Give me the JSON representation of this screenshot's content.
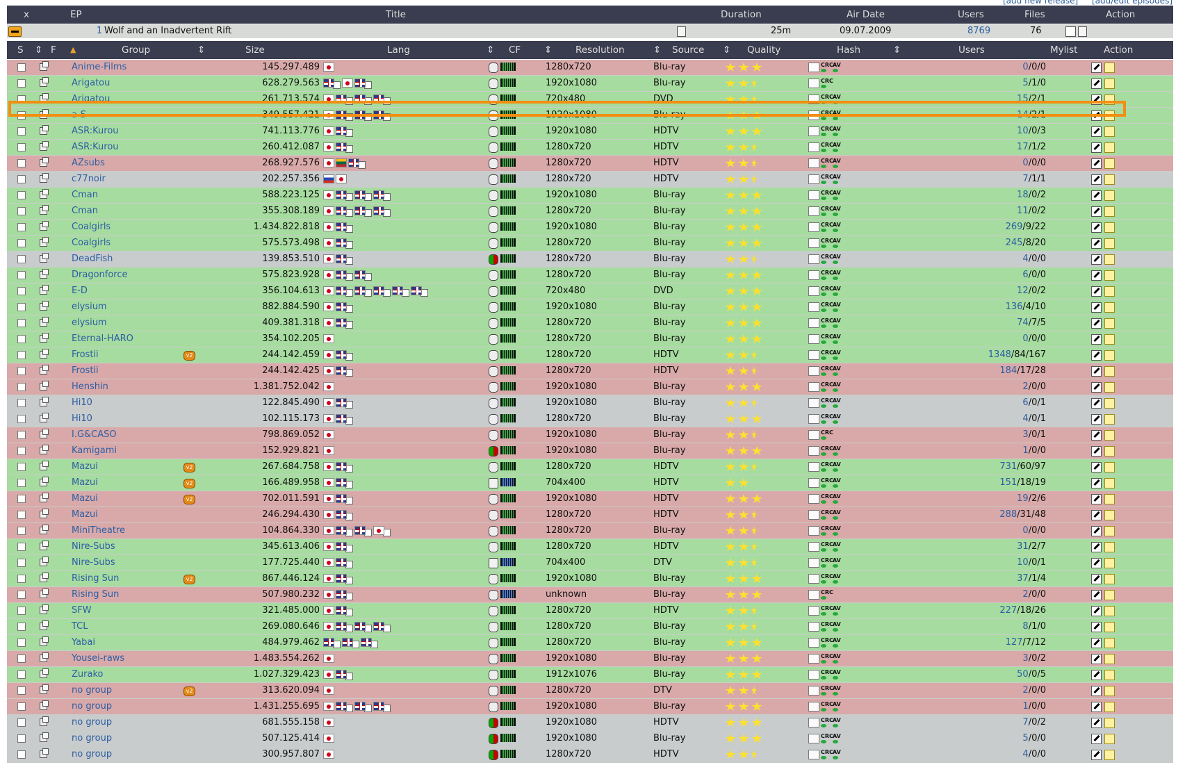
{
  "toplinks": [
    "[add new release]",
    "[add/edit episodes]"
  ],
  "episode_header": {
    "x": "x",
    "ep": "EP",
    "title": "Title",
    "duration": "Duration",
    "airdate": "Air Date",
    "users": "Users",
    "files": "Files",
    "action": "Action"
  },
  "episode": {
    "number": "1",
    "title": "Wolf and an Inadvertent Rift",
    "duration": "25m",
    "airdate": "09.07.2009",
    "users": "8769",
    "files": "76"
  },
  "group_header": {
    "s": "S",
    "f": "F",
    "group": "Group",
    "size": "Size",
    "lang": "Lang",
    "cf": "CF",
    "resolution": "Resolution",
    "source": "Source",
    "quality": "Quality",
    "hash": "Hash",
    "users": "Users",
    "mylist": "Mylist",
    "action": "Action"
  },
  "rows": [
    {
      "group": "Anime-Films",
      "size": "145.297.489",
      "langs": [
        "jp"
      ],
      "cf": "normal",
      "res": "1280x720",
      "src": "Blu-ray",
      "q": "3",
      "hash": "full",
      "users": "0/0/0",
      "color": "pink"
    },
    {
      "group": "Arigatou",
      "size": "628.279.563",
      "langs": [
        "en",
        "jp",
        "sub-en"
      ],
      "cf": "normal",
      "res": "1920x1080",
      "src": "Blu-ray",
      "q": "2.5",
      "hash": "part",
      "users": "5/1/0",
      "color": "green"
    },
    {
      "group": "Arigatou",
      "size": "261.713.574",
      "langs": [
        "jp",
        "en",
        "en",
        "en"
      ],
      "cf": "normal",
      "res": "720x480",
      "src": "DVD",
      "q": "2.5",
      "hash": "full",
      "users": "15/2/1",
      "color": "green"
    },
    {
      "group": "a-S",
      "size": "349.557.421",
      "langs": [
        "jp",
        "en",
        "en",
        "en"
      ],
      "cf": "normal",
      "res": "1920x1080",
      "src": "Blu-ray",
      "q": "3",
      "hash": "full",
      "users": "14/2/1",
      "color": "green"
    },
    {
      "group": "ASR:Kurou",
      "size": "741.113.776",
      "langs": [
        "jp",
        "en"
      ],
      "cf": "normal",
      "res": "1920x1080",
      "src": "HDTV",
      "q": "3",
      "hash": "full",
      "users": "10/0/3",
      "color": "green"
    },
    {
      "group": "ASR:Kurou",
      "size": "260.412.087",
      "langs": [
        "jp",
        "en"
      ],
      "cf": "normal",
      "res": "1280x720",
      "src": "HDTV",
      "q": "2.5",
      "hash": "full",
      "users": "17/1/2",
      "color": "green"
    },
    {
      "group": "AZsubs",
      "size": "268.927.576",
      "langs": [
        "jp",
        "lt",
        "en"
      ],
      "cf": "normal",
      "res": "1280x720",
      "src": "HDTV",
      "q": "2.5",
      "hash": "full",
      "users": "0/0/0",
      "color": "pink"
    },
    {
      "group": "c77noir",
      "size": "202.257.356",
      "langs": [
        "ru",
        "jp"
      ],
      "cf": "normal",
      "res": "1280x720",
      "src": "HDTV",
      "q": "2.5",
      "hash": "full",
      "users": "7/1/1",
      "color": "gray"
    },
    {
      "group": "Cman",
      "size": "588.223.125",
      "langs": [
        "jp",
        "en",
        "en",
        "en"
      ],
      "cf": "normal",
      "res": "1920x1080",
      "src": "Blu-ray",
      "q": "3",
      "hash": "full",
      "users": "18/0/2",
      "color": "green"
    },
    {
      "group": "Cman",
      "size": "355.308.189",
      "langs": [
        "jp",
        "en",
        "en",
        "en"
      ],
      "cf": "normal",
      "res": "1280x720",
      "src": "Blu-ray",
      "q": "3",
      "hash": "full",
      "users": "11/0/2",
      "color": "green"
    },
    {
      "group": "Coalgirls",
      "size": "1.434.822.818",
      "langs": [
        "jp",
        "en"
      ],
      "cf": "normal",
      "res": "1920x1080",
      "src": "Blu-ray",
      "q": "3",
      "hash": "full",
      "users": "269/9/22",
      "color": "green"
    },
    {
      "group": "Coalgirls",
      "size": "575.573.498",
      "langs": [
        "jp",
        "en"
      ],
      "cf": "normal",
      "res": "1280x720",
      "src": "Blu-ray",
      "q": "3",
      "hash": "full",
      "users": "245/8/20",
      "color": "green"
    },
    {
      "group": "DeadFish",
      "size": "139.853.510",
      "langs": [
        "jp",
        "en"
      ],
      "cf": "mix",
      "res": "1280x720",
      "src": "Blu-ray",
      "q": "2.5",
      "hash": "full",
      "users": "4/0/0",
      "color": "gray"
    },
    {
      "group": "Dragonforce",
      "size": "575.823.928",
      "langs": [
        "jp",
        "en",
        "en"
      ],
      "cf": "normal",
      "res": "1280x720",
      "src": "Blu-ray",
      "q": "3",
      "hash": "full",
      "users": "6/0/0",
      "color": "green"
    },
    {
      "group": "E-D",
      "size": "356.104.613",
      "langs": [
        "jp",
        "en",
        "en",
        "en",
        "en",
        "en"
      ],
      "cf": "normal",
      "res": "720x480",
      "src": "DVD",
      "q": "3",
      "hash": "full",
      "users": "12/0/2",
      "color": "green"
    },
    {
      "group": "elysium",
      "size": "882.884.590",
      "langs": [
        "jp",
        "en"
      ],
      "cf": "normal",
      "res": "1920x1080",
      "src": "Blu-ray",
      "q": "3",
      "hash": "full",
      "users": "136/4/10",
      "color": "green"
    },
    {
      "group": "elysium",
      "size": "409.381.318",
      "langs": [
        "jp",
        "en"
      ],
      "cf": "normal",
      "res": "1280x720",
      "src": "Blu-ray",
      "q": "3",
      "hash": "full",
      "users": "74/7/5",
      "color": "green"
    },
    {
      "group": "Eternal-HARO",
      "size": "354.102.205",
      "langs": [
        "jp"
      ],
      "cf": "normal",
      "res": "1280x720",
      "src": "Blu-ray",
      "q": "3",
      "hash": "full",
      "users": "0/0/0",
      "color": "green"
    },
    {
      "group": "Frostii",
      "v2": "v2",
      "size": "244.142.459",
      "langs": [
        "jp",
        "en"
      ],
      "cf": "normal",
      "res": "1280x720",
      "src": "HDTV",
      "q": "2.5",
      "hash": "full",
      "users": "1348/84/167",
      "color": "green"
    },
    {
      "group": "Frostii",
      "size": "244.142.425",
      "langs": [
        "jp",
        "en"
      ],
      "cf": "normal",
      "res": "1280x720",
      "src": "HDTV",
      "q": "2.5",
      "hash": "full",
      "users": "184/17/28",
      "color": "pink"
    },
    {
      "group": "Henshin",
      "size": "1.381.752.042",
      "langs": [
        "jp"
      ],
      "cf": "normal",
      "res": "1920x1080",
      "src": "Blu-ray",
      "q": "3",
      "hash": "full",
      "users": "2/0/0",
      "color": "pink"
    },
    {
      "group": "Hi10",
      "size": "122.845.490",
      "langs": [
        "jp",
        "en"
      ],
      "cf": "normal",
      "res": "1920x1080",
      "src": "Blu-ray",
      "q": "2.5",
      "hash": "full",
      "users": "6/0/1",
      "color": "gray"
    },
    {
      "group": "Hi10",
      "size": "102.115.173",
      "langs": [
        "jp",
        "en"
      ],
      "cf": "normal",
      "res": "1280x720",
      "src": "Blu-ray",
      "q": "3",
      "hash": "full",
      "users": "4/0/1",
      "color": "gray"
    },
    {
      "group": "I.G&CASO",
      "size": "798.869.052",
      "langs": [
        "jp"
      ],
      "cf": "normal",
      "res": "1920x1080",
      "src": "Blu-ray",
      "q": "2.5",
      "hash": "crc",
      "users": "3/0/1",
      "color": "pink"
    },
    {
      "group": "Kamigami",
      "size": "152.929.821",
      "langs": [
        "jp"
      ],
      "cf": "mix",
      "res": "1920x1080",
      "src": "Blu-ray",
      "q": "3",
      "hash": "full",
      "users": "1/0/0",
      "color": "pink"
    },
    {
      "group": "Mazui",
      "v2": "v2",
      "size": "267.684.758",
      "langs": [
        "jp",
        "en"
      ],
      "cf": "normal",
      "res": "1280x720",
      "src": "HDTV",
      "q": "2.5",
      "hash": "full",
      "users": "731/60/97",
      "color": "green"
    },
    {
      "group": "Mazui",
      "v2": "v2",
      "size": "166.489.958",
      "langs": [
        "jp",
        "en"
      ],
      "cf": "square",
      "res": "704x400",
      "src": "HDTV",
      "q": "2",
      "hash": "full",
      "users": "151/18/19",
      "color": "green"
    },
    {
      "group": "Mazui",
      "v2": "v2",
      "size": "702.011.591",
      "langs": [
        "jp",
        "en"
      ],
      "cf": "normal",
      "res": "1920x1080",
      "src": "HDTV",
      "q": "3",
      "hash": "full",
      "users": "19/2/6",
      "color": "pink"
    },
    {
      "group": "Mazui",
      "size": "246.294.430",
      "langs": [
        "jp",
        "en"
      ],
      "cf": "normal",
      "res": "1280x720",
      "src": "HDTV",
      "q": "2.5",
      "hash": "full",
      "users": "288/31/48",
      "color": "pink"
    },
    {
      "group": "MiniTheatre",
      "size": "104.864.330",
      "langs": [
        "jp",
        "en",
        "en",
        "jp-sub"
      ],
      "cf": "normal",
      "res": "1280x720",
      "src": "Blu-ray",
      "q": "2.5",
      "hash": "full",
      "users": "0/0/0",
      "color": "pink"
    },
    {
      "group": "Nire-Subs",
      "size": "345.613.406",
      "langs": [
        "jp",
        "en"
      ],
      "cf": "normal",
      "res": "1280x720",
      "src": "HDTV",
      "q": "2.5",
      "hash": "full",
      "users": "31/2/7",
      "color": "green"
    },
    {
      "group": "Nire-Subs",
      "size": "177.725.440",
      "langs": [
        "jp",
        "en"
      ],
      "cf": "square",
      "res": "704x400",
      "src": "DTV",
      "q": "2.5",
      "hash": "full",
      "users": "10/0/1",
      "color": "green"
    },
    {
      "group": "Rising Sun",
      "v2": "v2",
      "size": "867.446.124",
      "langs": [
        "jp",
        "en"
      ],
      "cf": "normal",
      "res": "1920x1080",
      "src": "Blu-ray",
      "q": "3",
      "hash": "full",
      "users": "37/1/4",
      "color": "green"
    },
    {
      "group": "Rising Sun",
      "size": "507.980.232",
      "langs": [
        "jp",
        "en"
      ],
      "cf": "blue",
      "res": "unknown",
      "src": "Blu-ray",
      "q": "3",
      "hash": "crc",
      "users": "2/0/0",
      "color": "pink"
    },
    {
      "group": "SFW",
      "size": "321.485.000",
      "langs": [
        "jp",
        "en"
      ],
      "cf": "normal",
      "res": "1280x720",
      "src": "HDTV",
      "q": "2.5",
      "hash": "full",
      "users": "227/18/26",
      "color": "green"
    },
    {
      "group": "TCL",
      "size": "269.080.646",
      "langs": [
        "jp",
        "en",
        "en",
        "en"
      ],
      "cf": "normal",
      "res": "1280x720",
      "src": "Blu-ray",
      "q": "2.5",
      "hash": "full",
      "users": "8/1/0",
      "color": "green"
    },
    {
      "group": "Yabai",
      "size": "484.979.462",
      "langs": [
        "en",
        "en",
        "en"
      ],
      "cf": "normal",
      "res": "1280x720",
      "src": "Blu-ray",
      "q": "3",
      "hash": "full",
      "users": "127/7/12",
      "color": "green"
    },
    {
      "group": "Yousei-raws",
      "size": "1.483.554.262",
      "langs": [
        "jp"
      ],
      "cf": "normal",
      "res": "1920x1080",
      "src": "Blu-ray",
      "q": "3",
      "hash": "full",
      "users": "3/0/2",
      "color": "pink"
    },
    {
      "group": "Zurako",
      "size": "1.027.329.423",
      "langs": [
        "jp",
        "en"
      ],
      "cf": "normal",
      "res": "1912x1076",
      "src": "Blu-ray",
      "q": "3",
      "hash": "full",
      "users": "50/0/5",
      "color": "green"
    },
    {
      "group": "no group",
      "v2": "v2",
      "size": "313.620.094",
      "langs": [
        "jp"
      ],
      "cf": "normal",
      "res": "1280x720",
      "src": "DTV",
      "q": "2.5",
      "hash": "full",
      "users": "2/0/0",
      "color": "pink"
    },
    {
      "group": "no group",
      "size": "1.431.255.695",
      "langs": [
        "jp",
        "en",
        "en",
        "en"
      ],
      "cf": "normal",
      "res": "1920x1080",
      "src": "Blu-ray",
      "q": "3",
      "hash": "full",
      "users": "1/0/0",
      "color": "pink"
    },
    {
      "group": "no group",
      "size": "681.555.158",
      "langs": [
        "jp"
      ],
      "cf": "mix",
      "res": "1920x1080",
      "src": "HDTV",
      "q": "3",
      "hash": "full",
      "users": "7/0/2",
      "color": "gray"
    },
    {
      "group": "no group",
      "size": "507.125.414",
      "langs": [
        "jp"
      ],
      "cf": "mix",
      "res": "1920x1080",
      "src": "Blu-ray",
      "q": "3",
      "hash": "full",
      "users": "5/0/0",
      "color": "gray"
    },
    {
      "group": "no group",
      "size": "300.957.807",
      "langs": [
        "jp"
      ],
      "cf": "mix",
      "res": "1280x720",
      "src": "HDTV",
      "q": "2.5",
      "hash": "full",
      "users": "4/0/0",
      "color": "gray"
    }
  ],
  "colors": {
    "header": "#3a3c4f",
    "green": "#a7dca0",
    "pink": "#d9a9a9",
    "gray": "#c9cccc",
    "link": "#2b5ea4",
    "highlight": "#f28e12"
  }
}
